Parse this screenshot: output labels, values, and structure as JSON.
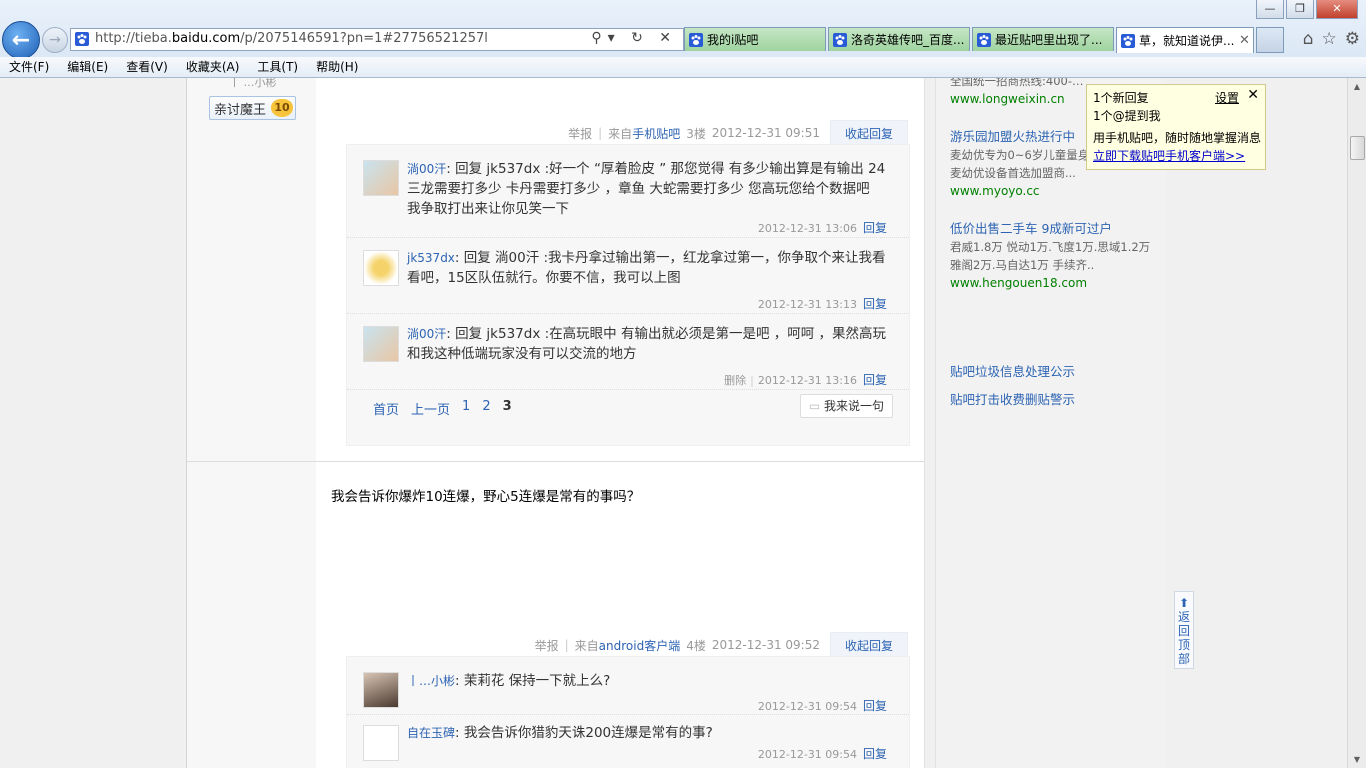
{
  "window": {
    "minimize": "—",
    "restore": "❐",
    "close": "✕"
  },
  "nav": {
    "back": "←",
    "forward": "→"
  },
  "address": {
    "url_prefix": "http://tieba.",
    "url_host": "baidu.com",
    "url_rest": "/p/2075146591?pn=1#27756521257l",
    "tools": "⚲▾ ↻ ✕"
  },
  "tabs": [
    {
      "title": "我的i贴吧"
    },
    {
      "title": "洛奇英雄传吧_百度..."
    },
    {
      "title": "最近贴吧里出现了..."
    },
    {
      "title": "草，就知道说伊...",
      "close": "✕"
    }
  ],
  "toolbar_icons": {
    "home": "⌂",
    "favorites": "☆",
    "tools": "⚙"
  },
  "menu": [
    "文件(F)",
    "编辑(E)",
    "查看(V)",
    "收藏夹(A)",
    "工具(T)",
    "帮助(H)"
  ],
  "scrollbar": {
    "up": "▲",
    "down": "▼"
  },
  "left": {
    "cutoff": "丨 …小彬",
    "badge": "亲讨魔王",
    "level": "10"
  },
  "post3": {
    "report": "举报",
    "from": "来自",
    "client": "手机贴吧",
    "floor": "3楼",
    "time": "2012-12-31 09:51",
    "fold": "收起回复",
    "replies": [
      {
        "user": "淌00汗",
        "text": "回复 jk537dx :好一个 “厚着脸皮 ” 那您觉得 有多少输出算是有输出 24三龙需要打多少 卡丹需要打多少 ，章鱼 大蛇需要打多少 您高玩您给个数据吧 我争取打出来让你见笑一下",
        "time": "2012-12-31 13:06",
        "reply": "回复"
      },
      {
        "user": "jk537dx",
        "text": "回复 淌00汗 :我卡丹拿过输出第一，红龙拿过第一，你争取个来让我看看吧，15区队伍就行。你要不信，我可以上图",
        "time": "2012-12-31 13:13",
        "reply": "回复"
      },
      {
        "user": "淌00汗",
        "text": "回复 jk537dx :在高玩眼中 有输出就必须是第一是吧 ，呵呵 ，果然高玩和我这种低端玩家没有可以交流的地方",
        "del": "删除",
        "time": "2012-12-31 13:16",
        "reply": "回复"
      }
    ],
    "pager": {
      "first": "首页",
      "prev": "上一页",
      "p1": "1",
      "p2": "2",
      "p3": "3"
    },
    "say": "我来说一句"
  },
  "post4": {
    "content": "我会告诉你爆炸10连爆，野心5连爆是常有的事吗？",
    "report": "举报",
    "from": "来自",
    "client": "android客户端",
    "floor": "4楼",
    "time": "2012-12-31 09:52",
    "fold": "收起回复",
    "replies": [
      {
        "user": "丨…小彬",
        "text": "茉莉花 保持一下就上么?",
        "time": "2012-12-31 09:54",
        "reply": "回复"
      },
      {
        "user": "自在玉碑",
        "text": "我会告诉你猎豹天诛200连爆是常有的事?",
        "time": "2012-12-31 09:54",
        "reply": "回复"
      }
    ]
  },
  "side": {
    "top_cut": "全国统一招商热线:400-…",
    "top_url": "www.longweixin.cn",
    "ads": [
      {
        "title": "游乐园加盟火热进行中",
        "desc": "麦幼优专为0~6岁儿童量身定做的游乐园 麦幼优设备首选加盟商...",
        "url": "www.myoyo.cc"
      },
      {
        "title": "低价出售二手车 9成新可过户",
        "desc": "君威1.8万 悦动1万.飞度1万.思域1.2万 雅阁2万.马自达1万 手续齐..",
        "url": "www.hengouen18.com"
      }
    ],
    "links": [
      "贴吧垃圾信息处理公示",
      "贴吧打击收费删贴警示"
    ]
  },
  "notify": {
    "line1": "1个新回复",
    "line2": "1个@提到我",
    "settings": "设置",
    "close": "✕",
    "line3": "用手机贴吧，随时随地掌握消息",
    "download": "立即下载贴吧手机客户端>>"
  },
  "backtop": {
    "arrow": "⬆",
    "label": "返回顶部"
  }
}
